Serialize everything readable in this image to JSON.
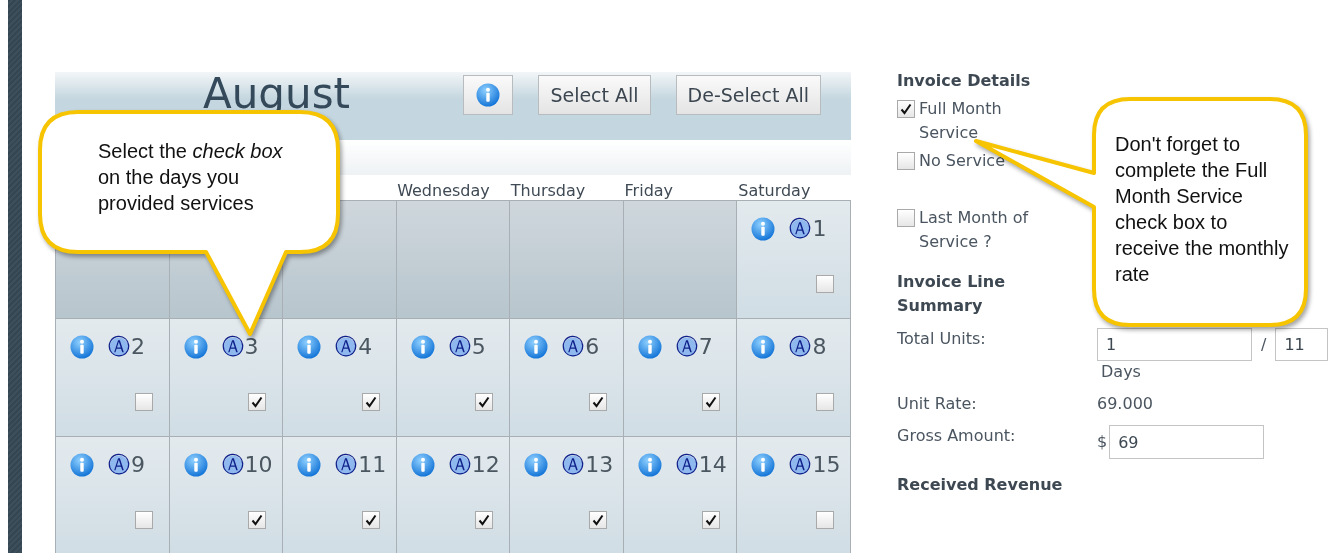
{
  "calendar": {
    "month": "August",
    "buttons": [
      "Select All",
      "De-Select All"
    ],
    "weekdays": [
      "Wednesday",
      "Thursday",
      "Friday",
      "Saturday"
    ],
    "weeks": [
      {
        "days": [
          {
            "kind": "blank"
          },
          {
            "kind": "blank"
          },
          {
            "kind": "blank"
          },
          {
            "kind": "blank"
          },
          {
            "kind": "blank"
          },
          {
            "kind": "blank"
          },
          {
            "kind": "day",
            "marker": "Ⓐ",
            "day": "1",
            "checked": false
          }
        ]
      },
      {
        "days": [
          {
            "kind": "day",
            "marker": "Ⓐ",
            "day": "2",
            "checked": false
          },
          {
            "kind": "day",
            "marker": "Ⓐ",
            "day": "3",
            "checked": true
          },
          {
            "kind": "day",
            "marker": "Ⓐ",
            "day": "4",
            "checked": true
          },
          {
            "kind": "day",
            "marker": "Ⓐ",
            "day": "5",
            "checked": true
          },
          {
            "kind": "day",
            "marker": "Ⓐ",
            "day": "6",
            "checked": true
          },
          {
            "kind": "day",
            "marker": "Ⓐ",
            "day": "7",
            "checked": true
          },
          {
            "kind": "day",
            "marker": "Ⓐ",
            "day": "8",
            "checked": false
          }
        ]
      },
      {
        "days": [
          {
            "kind": "day",
            "marker": "Ⓐ",
            "day": "9",
            "checked": false
          },
          {
            "kind": "day",
            "marker": "Ⓐ",
            "day": "10",
            "checked": true
          },
          {
            "kind": "day",
            "marker": "Ⓐ",
            "day": "11",
            "checked": true
          },
          {
            "kind": "day",
            "marker": "Ⓐ",
            "day": "12",
            "checked": true
          },
          {
            "kind": "day",
            "marker": "Ⓐ",
            "day": "13",
            "checked": true
          },
          {
            "kind": "day",
            "marker": "Ⓐ",
            "day": "14",
            "checked": true
          },
          {
            "kind": "day",
            "marker": "Ⓐ",
            "day": "15",
            "checked": false
          }
        ]
      }
    ]
  },
  "invoice": {
    "heading": "Invoice Details",
    "options": [
      {
        "label": "Full Month Service",
        "checked": true
      },
      {
        "label": "No Service",
        "checked": false
      },
      {
        "label": "Last Month of Service ?",
        "checked": false
      }
    ],
    "summary_heading": "Invoice Line Summary",
    "total_units": {
      "label": "Total Units:",
      "value": "1",
      "separator": "/",
      "total": "11",
      "unit": "Days"
    },
    "unit_rate": {
      "label": "Unit Rate:",
      "value": "69.000"
    },
    "gross_amount": {
      "label": "Gross Amount:",
      "currency": "$",
      "value": "69"
    },
    "revenue_heading": "Received Revenue"
  },
  "callouts": [
    {
      "text": "Select the *check box* on the days you provided services"
    },
    {
      "text": "Don't forget to complete the Full Month Service check box to receive the monthly rate"
    }
  ]
}
